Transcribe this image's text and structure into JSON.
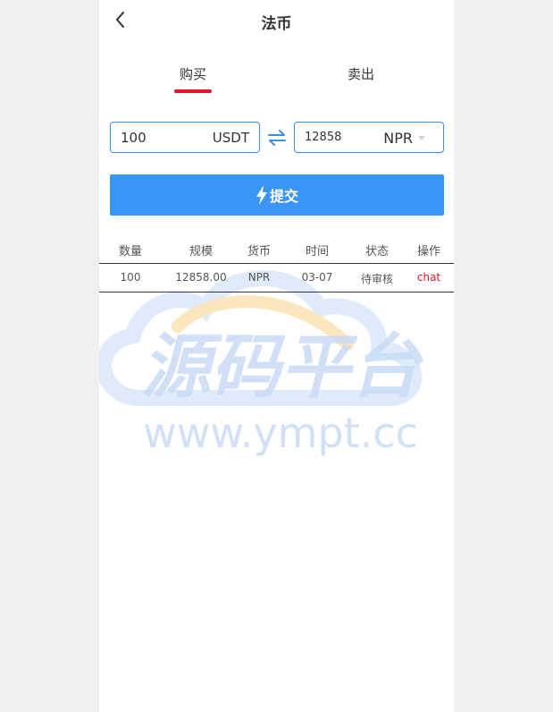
{
  "header": {
    "title": "法币"
  },
  "tabs": [
    {
      "label": "购买",
      "active": true
    },
    {
      "label": "卖出",
      "active": false
    }
  ],
  "exchange": {
    "from_amount": "100",
    "from_unit": "USDT",
    "to_amount": "12858",
    "to_currency": "NPR"
  },
  "submit_label": "提交",
  "table": {
    "columns": [
      "数量",
      "规模",
      "货币",
      "时间",
      "状态",
      "操作"
    ],
    "rows": [
      {
        "quantity": "100",
        "scale": "12858.00",
        "currency": "NPR",
        "time": "03-07",
        "status": "待审核",
        "action": "chat"
      }
    ]
  },
  "watermark": {
    "text_cn": "源码平台",
    "text_url": "www.ympt.cc"
  },
  "colors": {
    "accent": "#3b95f5",
    "active_underline": "#e0162b",
    "link": "#e0162b",
    "border": "#3b8ee6"
  }
}
